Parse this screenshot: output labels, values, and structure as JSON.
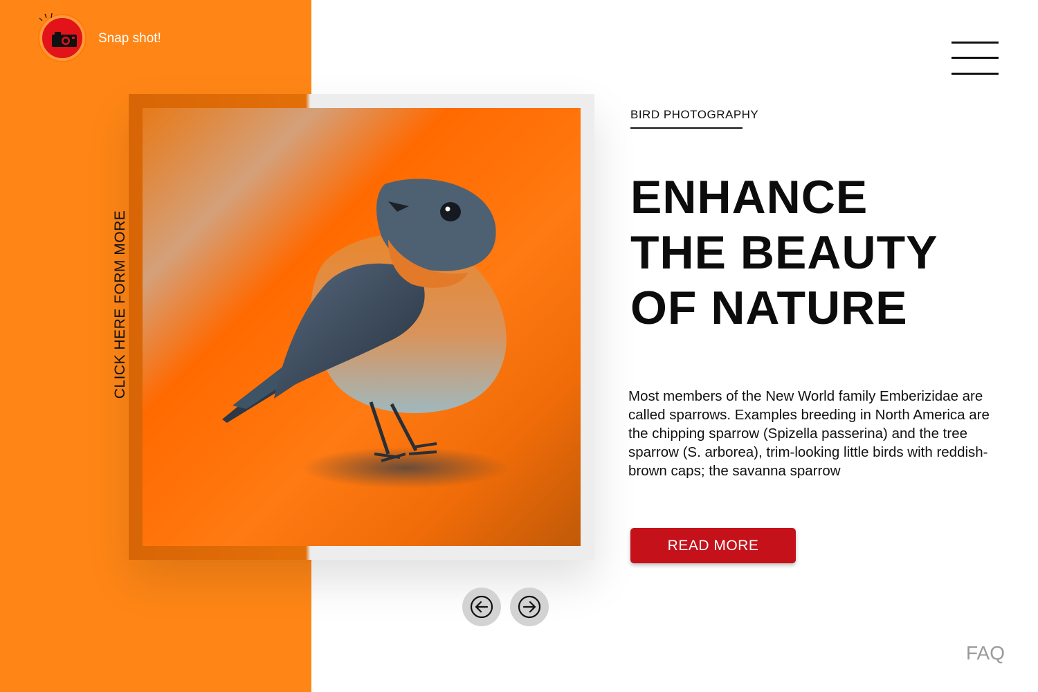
{
  "brand": {
    "name": "Snap shot!",
    "logo_icon": "camera-icon",
    "logo_color": "#e3131a"
  },
  "side_link": {
    "label": "CLICK HERE FORM MORE"
  },
  "hero": {
    "eyebrow": "BIRD PHOTOGRAPHY",
    "headline": [
      "ENHANCE",
      "THE BEAUTY",
      "OF NATURE"
    ],
    "body": "Most members of the New World family Emberizidae are called sparrows. Examples breeding in North America are the chipping sparrow (Spizella passerina) and the tree sparrow (S. arborea), trim-looking little birds with reddish-brown caps; the savanna sparrow",
    "cta_label": "READ MORE"
  },
  "gallery": {
    "prev_icon": "arrow-left-icon",
    "next_icon": "arrow-right-icon"
  },
  "menu": {
    "icon": "hamburger-menu-icon"
  },
  "footer": {
    "faq_label": "FAQ"
  },
  "colors": {
    "accent_orange": "#ff8616",
    "cta_red": "#c5111a",
    "text_dark": "#111111",
    "muted_gray": "#9a9a9a"
  }
}
